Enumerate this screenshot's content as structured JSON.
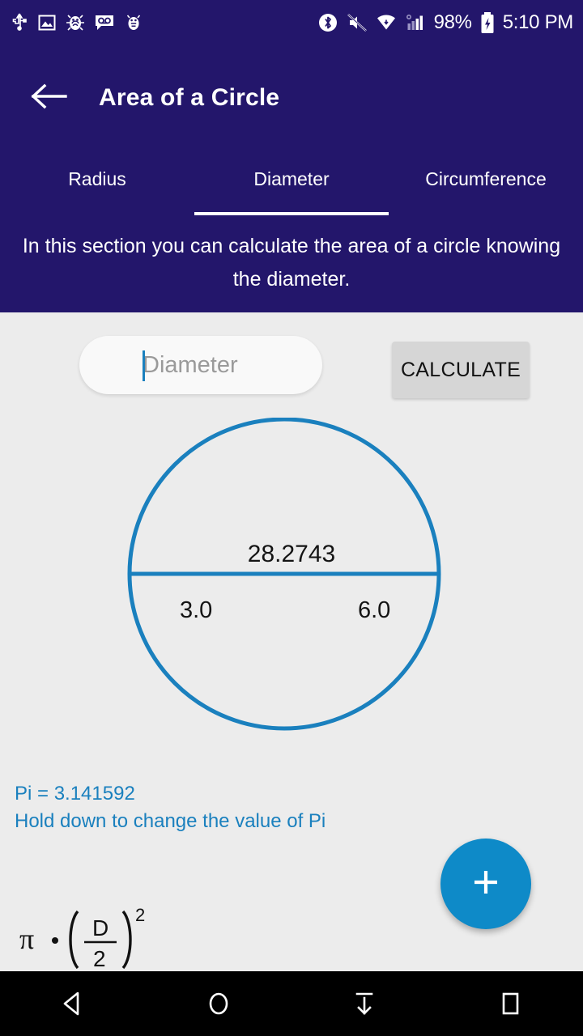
{
  "statusbar": {
    "icons_left": [
      "usb-icon",
      "screenshot-icon",
      "debug-bug-icon",
      "voicemail-icon",
      "android-icon"
    ],
    "icons_right": [
      "bluetooth-icon",
      "mute-icon",
      "wifi-icon",
      "cellular-signal-icon"
    ],
    "battery_percent": "98%",
    "battery_icon": "battery-charging-icon",
    "time": "5:10 PM"
  },
  "appbar": {
    "back_icon": "arrow-left-icon",
    "title": "Area of a Circle"
  },
  "tabs": {
    "items": [
      {
        "label": "Radius",
        "active": false
      },
      {
        "label": "Diameter",
        "active": true
      },
      {
        "label": "Circumference",
        "active": false
      }
    ]
  },
  "description": {
    "text": "In this section you can calculate the area of a circle knowing the diameter."
  },
  "input": {
    "placeholder": "Diameter",
    "value": ""
  },
  "calculate_button": {
    "label": "CALCULATE"
  },
  "diagram": {
    "area_label": "28.2743",
    "radius_label": "3.0",
    "diameter_label": "6.0",
    "stroke_color": "#1A80BE"
  },
  "pi": {
    "value_text": "Pi = 3.141592",
    "hint_text": "Hold down to change the value of Pi",
    "color": "#1A80BE"
  },
  "fab": {
    "icon": "plus-icon",
    "color": "#0E8AC8"
  },
  "formula": {
    "pi_symbol": "π",
    "dot": "•",
    "numerator": "D",
    "denominator": "2",
    "exponent": "2"
  },
  "navbar": {
    "items": [
      "back-nav-icon",
      "home-nav-icon",
      "hide-keyboard-icon",
      "recents-nav-icon"
    ]
  },
  "colors": {
    "primary": "#23166B",
    "background": "#ECECEC",
    "accent": "#1A80BE",
    "fab": "#0E8AC8",
    "button": "#D6D6D6"
  }
}
